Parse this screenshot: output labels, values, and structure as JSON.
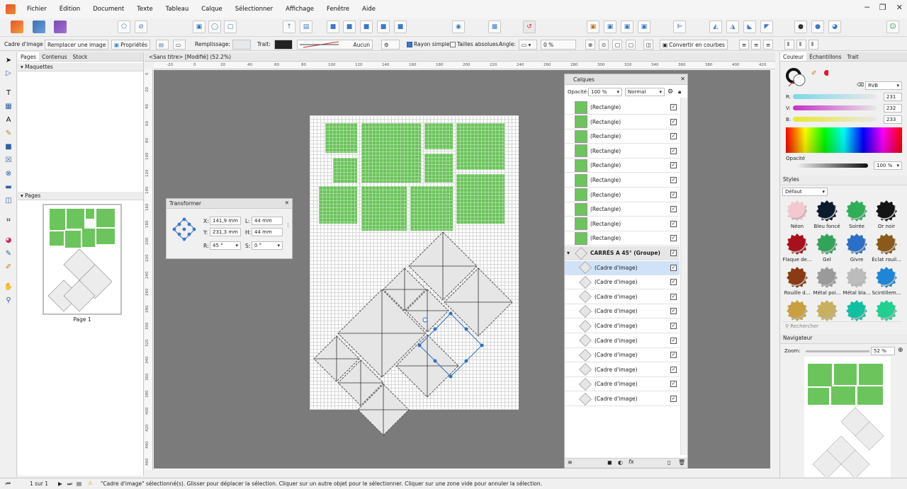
{
  "menubar": {
    "items": [
      "Fichier",
      "Édition",
      "Document",
      "Texte",
      "Tableau",
      "Calque",
      "Sélectionner",
      "Affichage",
      "Fenêtre",
      "Aide"
    ]
  },
  "context": {
    "tool": "Cadre d'image",
    "replace": "Remplacer une image",
    "props": "Propriétés",
    "fill": "Remplissage:",
    "stroke": "Trait:",
    "none": "Aucun",
    "single": "Rayon simple",
    "abs": "Tailles absolues",
    "angle": "Angle:",
    "angle_val": "0 %",
    "convert": "Convertir en courbes"
  },
  "pages_panel": {
    "tabs": [
      "Pages",
      "Contenus",
      "Stock"
    ],
    "masters": "Maquettes",
    "pages": "Pages",
    "page_label": "Page 1"
  },
  "doc": {
    "tab": "<Sans titre> [Modifié] (52.2%)"
  },
  "ruler": {
    "h": [
      "-20",
      "0",
      "20",
      "40",
      "60",
      "80",
      "100",
      "120",
      "140",
      "160",
      "180",
      "200",
      "220",
      "240",
      "260",
      "280",
      "300",
      "320",
      "340",
      "360",
      "380",
      "400",
      "420",
      "440",
      "460"
    ],
    "v": [
      "0",
      "20",
      "40",
      "60",
      "80",
      "100",
      "120",
      "140",
      "160",
      "180",
      "200",
      "220",
      "240",
      "260",
      "280",
      "300",
      "320",
      "340",
      "360",
      "380",
      "400",
      "420",
      "440",
      "460"
    ]
  },
  "transformer": {
    "title": "Transformer",
    "x_label": "X:",
    "x": "141,9 mm",
    "y_label": "Y:",
    "y": "231,3 mm",
    "w_label": "L:",
    "w": "44 mm",
    "h_label": "H:",
    "h": "44 mm",
    "r_label": "R:",
    "r": "45 °",
    "s_label": "S:",
    "s": "0 °"
  },
  "layers": {
    "title": "Calques",
    "opacity_label": "Opacité:",
    "opacity": "100 %",
    "blend": "Normal",
    "rows": [
      "(Rectangle)",
      "(Rectangle)",
      "(Rectangle)",
      "(Rectangle)",
      "(Rectangle)",
      "(Rectangle)",
      "(Rectangle)",
      "(Rectangle)",
      "(Rectangle)",
      "(Rectangle)",
      "CARRÉS A 45° (Groupe)",
      "(Cadre d'image)",
      "(Cadre d'image)",
      "(Cadre d'image)",
      "(Cadre d'image)",
      "(Cadre d'image)",
      "(Cadre d'image)",
      "(Cadre d'image)",
      "(Cadre d'image)",
      "(Cadre d'image)",
      "(Cadre d'image)"
    ]
  },
  "colour": {
    "tabs": [
      "Couleur",
      "Échantillons",
      "Trait"
    ],
    "model": "RVB",
    "r_label": "R:",
    "r": "231",
    "g_label": "V:",
    "g": "232",
    "b_label": "B:",
    "b": "233",
    "opacity_label": "Opacité",
    "opacity": "100 %"
  },
  "styles": {
    "title": "Styles",
    "category": "Défaut",
    "search": "Rechercher",
    "items": [
      {
        "label": "Néon",
        "color": "#f4c8d0"
      },
      {
        "label": "Bleu foncé",
        "color": "#0d1a2e"
      },
      {
        "label": "Soirée",
        "color": "#2fae58"
      },
      {
        "label": "Or noir",
        "color": "#141414"
      },
      {
        "label": "Flaque de...",
        "color": "#a8101c"
      },
      {
        "label": "Gel",
        "color": "#34a35a"
      },
      {
        "label": "Givre",
        "color": "#2a6fc8"
      },
      {
        "label": "Éclat rouil...",
        "color": "#8a5a1c"
      },
      {
        "label": "Rouille d...",
        "color": "#8a3a14"
      },
      {
        "label": "Métal poi...",
        "color": "#9a9a9a"
      },
      {
        "label": "Métal bla...",
        "color": "#bcbcbc"
      },
      {
        "label": "Scintillem...",
        "color": "#1f86d6"
      },
      {
        "label": "",
        "color": "#c8a040"
      },
      {
        "label": "",
        "color": "#c8b060"
      },
      {
        "label": "",
        "color": "#10c0a0"
      },
      {
        "label": "",
        "color": "#20d090"
      }
    ]
  },
  "navigator": {
    "title": "Navigateur",
    "zoom_label": "Zoom:",
    "zoom": "52 %"
  },
  "status": {
    "page": "1 sur 1",
    "msg": "\"Cadre d'image\" sélectionné(s). Glisser pour déplacer la sélection. Cliquer sur un autre objet pour le sélectionner. Cliquer sur une zone vide pour annuler la sélection."
  }
}
